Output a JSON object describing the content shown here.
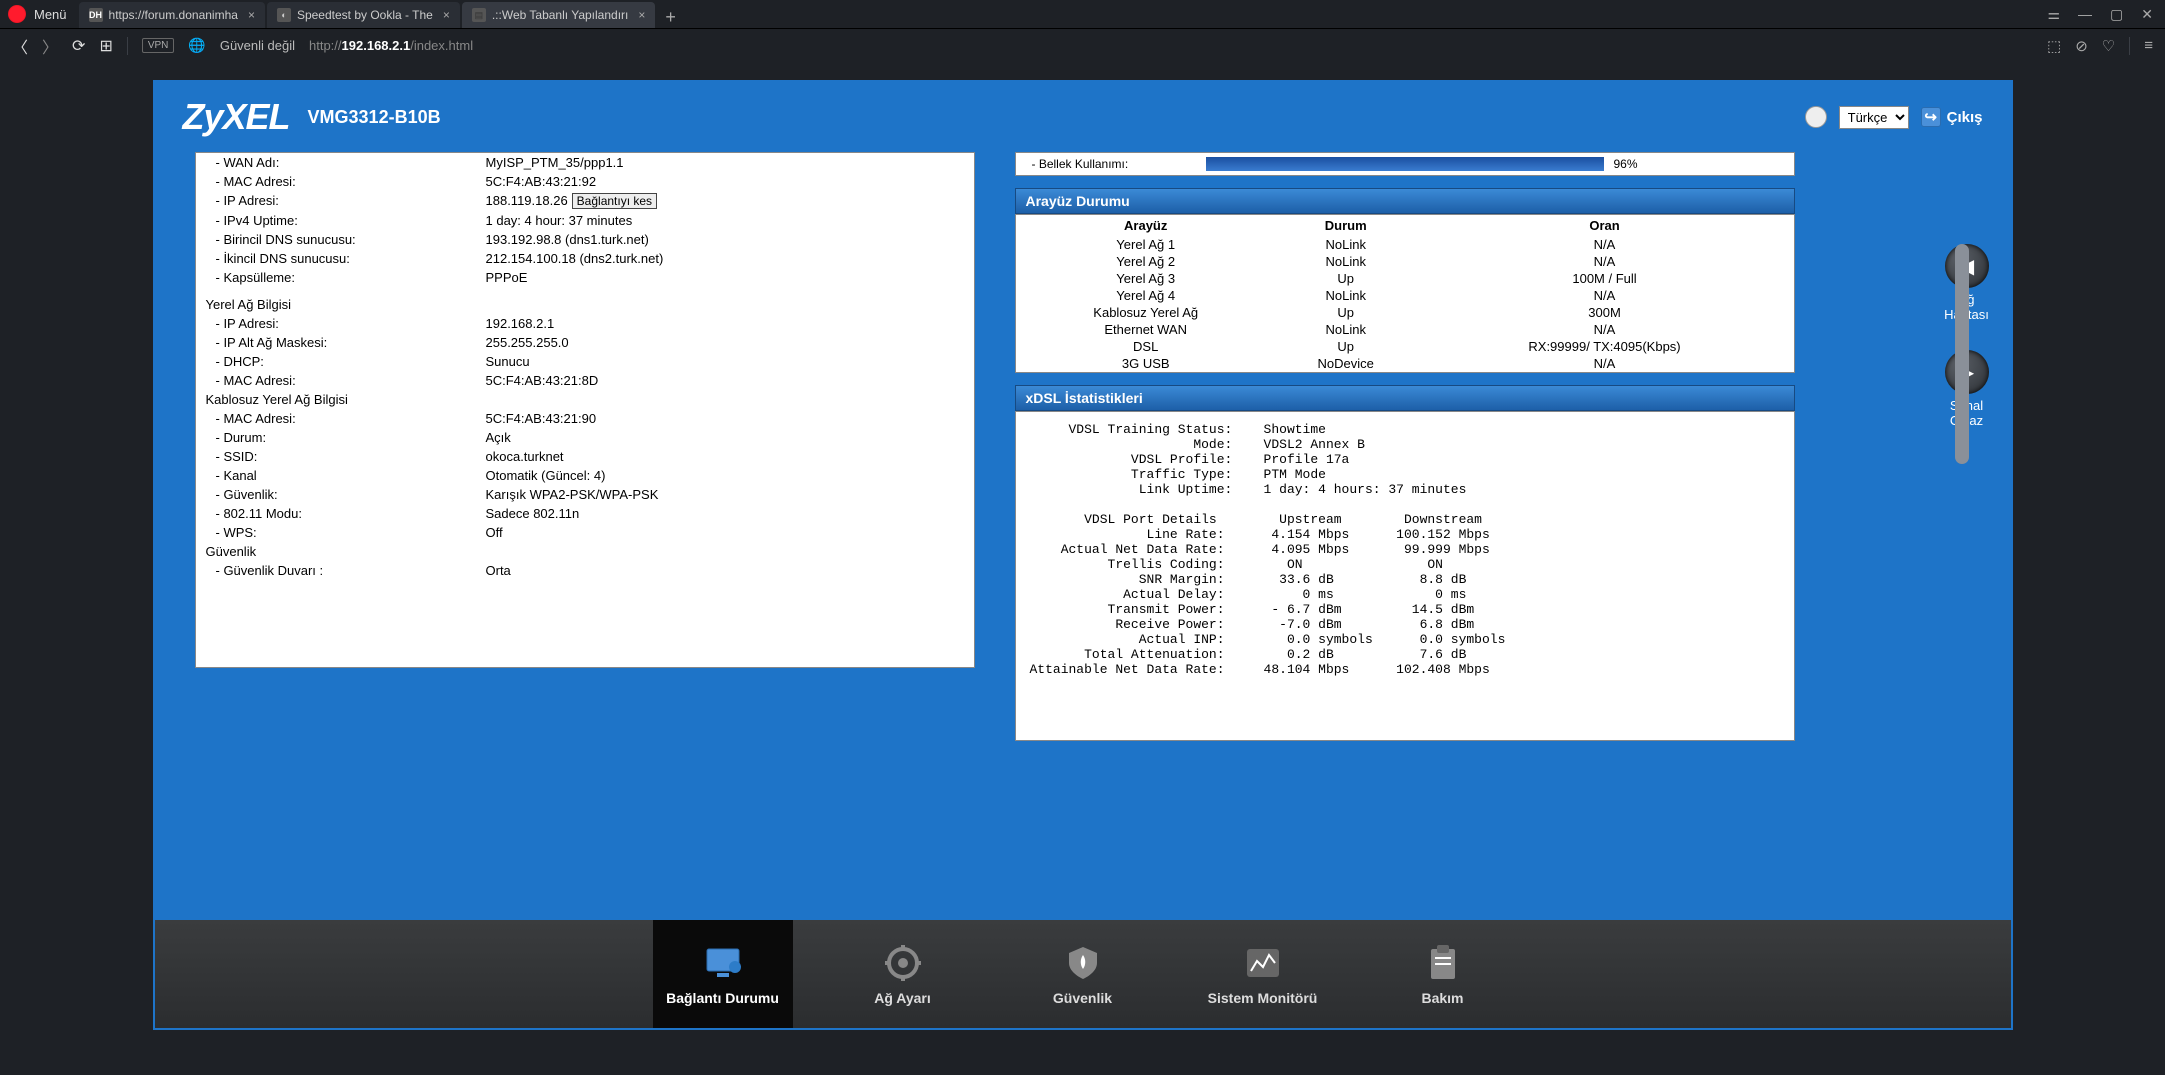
{
  "browser": {
    "menu_label": "Menü",
    "tabs": [
      {
        "label": "https://forum.donanimha",
        "fav": "DH"
      },
      {
        "label": "Speedtest by Ookla - The",
        "fav": "◐"
      },
      {
        "label": ".::Web Tabanlı Yapılandırı",
        "fav": "📄"
      }
    ],
    "insecure_label": "Güvenli değil",
    "url_prefix": "http://",
    "url_ip": "192.168.2.1",
    "url_path": "/index.html",
    "vpn": "VPN"
  },
  "header": {
    "brand": "ZyXEL",
    "model": "VMG3312-B10B",
    "lang": "Türkçe",
    "logout": "Çıkış"
  },
  "sidebuttons": {
    "map": "Ağ Haritası",
    "virtual": "Sanal Cihaz"
  },
  "wan": {
    "rows": [
      {
        "label": "- WAN Adı:",
        "value": "MyISP_PTM_35/ppp1.1"
      },
      {
        "label": "- MAC Adresi:",
        "value": "5C:F4:AB:43:21:92"
      },
      {
        "label": "- IP Adresi:",
        "value": "188.119.18.26",
        "button": "Bağlantıyı kes"
      },
      {
        "label": "- IPv4 Uptime:",
        "value": "1 day: 4 hour: 37 minutes"
      },
      {
        "label": "- Birincil DNS sunucusu:",
        "value": "193.192.98.8 (dns1.turk.net)"
      },
      {
        "label": "- İkincil DNS sunucusu:",
        "value": "212.154.100.18 (dns2.turk.net)"
      },
      {
        "label": "- Kapsülleme:",
        "value": "PPPoE"
      }
    ]
  },
  "lan": {
    "title": "Yerel Ağ Bilgisi",
    "rows": [
      {
        "label": "- IP Adresi:",
        "value": "192.168.2.1"
      },
      {
        "label": "- IP Alt Ağ Maskesi:",
        "value": "255.255.255.0"
      },
      {
        "label": "- DHCP:",
        "value": "Sunucu"
      },
      {
        "label": "- MAC Adresi:",
        "value": "5C:F4:AB:43:21:8D"
      }
    ]
  },
  "wlan": {
    "title": "Kablosuz Yerel Ağ Bilgisi",
    "rows": [
      {
        "label": "- MAC Adresi:",
        "value": "5C:F4:AB:43:21:90"
      },
      {
        "label": "- Durum:",
        "value": "Açık"
      },
      {
        "label": "- SSID:",
        "value": "okoca.turknet"
      },
      {
        "label": "- Kanal",
        "value": "Otomatik (Güncel: 4)"
      },
      {
        "label": "- Güvenlik:",
        "value": "Karışık WPA2-PSK/WPA-PSK"
      },
      {
        "label": "- 802.11 Modu:",
        "value": "Sadece 802.11n"
      },
      {
        "label": "- WPS:",
        "value": "Off"
      }
    ]
  },
  "security": {
    "title": "Güvenlik",
    "rows": [
      {
        "label": "- Güvenlik Duvarı :",
        "value": "Orta"
      }
    ]
  },
  "memory": {
    "label": "- Bellek Kullanımı:",
    "pct": "96%"
  },
  "iface": {
    "title": "Arayüz Durumu",
    "headers": {
      "a": "Arayüz",
      "b": "Durum",
      "c": "Oran"
    },
    "rows": [
      {
        "a": "Yerel Ağ 1",
        "b": "NoLink",
        "c": "N/A"
      },
      {
        "a": "Yerel Ağ 2",
        "b": "NoLink",
        "c": "N/A"
      },
      {
        "a": "Yerel Ağ 3",
        "b": "Up",
        "c": "100M / Full"
      },
      {
        "a": "Yerel Ağ 4",
        "b": "NoLink",
        "c": "N/A"
      },
      {
        "a": "Kablosuz Yerel Ağ",
        "b": "Up",
        "c": "300M"
      },
      {
        "a": "Ethernet WAN",
        "b": "NoLink",
        "c": "N/A"
      },
      {
        "a": "DSL",
        "b": "Up",
        "c": "RX:99999/ TX:4095(Kbps)"
      },
      {
        "a": "3G USB",
        "b": "NoDevice",
        "c": "N/A"
      }
    ]
  },
  "xdsl": {
    "title": "xDSL İstatistikleri",
    "text": "     VDSL Training Status:    Showtime\n                     Mode:    VDSL2 Annex B\n             VDSL Profile:    Profile 17a\n             Traffic Type:    PTM Mode\n              Link Uptime:    1 day: 4 hours: 37 minutes\n\n       VDSL Port Details        Upstream        Downstream\n               Line Rate:      4.154 Mbps      100.152 Mbps\n    Actual Net Data Rate:      4.095 Mbps       99.999 Mbps\n          Trellis Coding:        ON                ON\n              SNR Margin:       33.6 dB           8.8 dB\n            Actual Delay:          0 ms             0 ms\n          Transmit Power:      - 6.7 dBm         14.5 dBm\n           Receive Power:       -7.0 dBm          6.8 dBm\n              Actual INP:        0.0 symbols      0.0 symbols\n       Total Attenuation:        0.2 dB           7.6 dB\nAttainable Net Data Rate:     48.104 Mbps      102.408 Mbps"
  },
  "nav": {
    "items": [
      {
        "label": "Bağlantı Durumu"
      },
      {
        "label": "Ağ Ayarı"
      },
      {
        "label": "Güvenlik"
      },
      {
        "label": "Sistem Monitörü"
      },
      {
        "label": "Bakım"
      }
    ]
  }
}
